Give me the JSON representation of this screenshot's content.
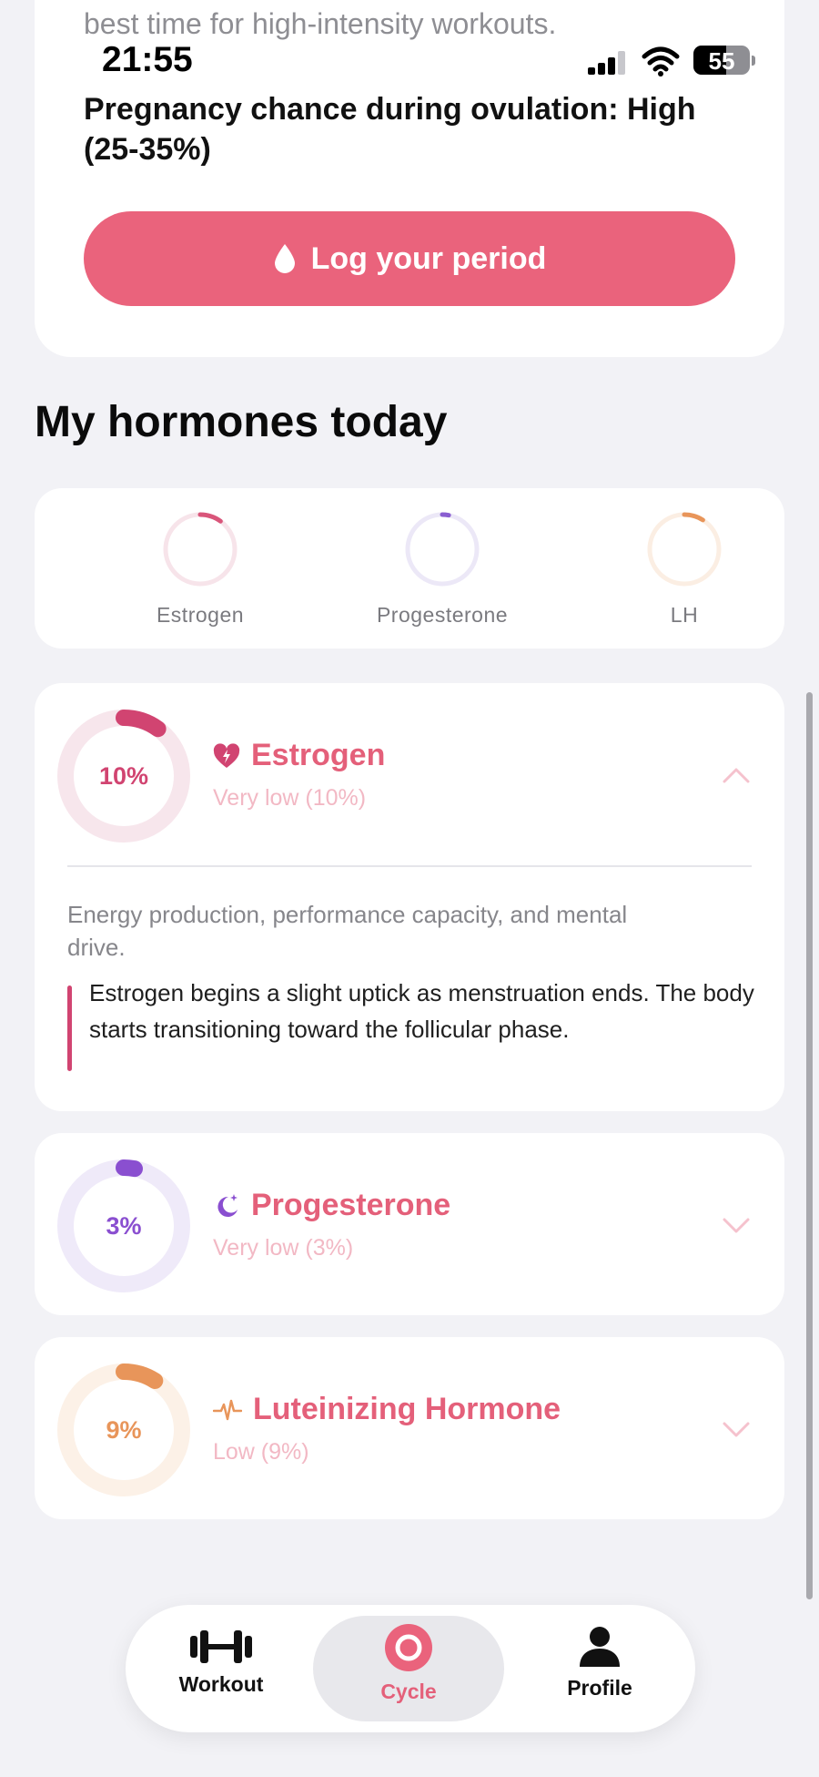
{
  "status_bar": {
    "time": "21:55",
    "battery": "55"
  },
  "top": {
    "faded_line": "best time for high-intensity workouts.",
    "pregnancy_text": "Pregnancy chance during ovulation: High (25-35%)",
    "log_button": "Log your period",
    "log_icon": "drop-icon"
  },
  "section_title": "My hormones today",
  "summary": [
    {
      "label": "Estrogen",
      "level": 0.1,
      "color": "#d9557a",
      "track": "#f7e4ea"
    },
    {
      "label": "Progesterone",
      "level": 0.03,
      "color": "#8a5fd1",
      "track": "#ece8f7"
    },
    {
      "label": "LH",
      "level": 0.09,
      "color": "#e8955a",
      "track": "#fbeee3"
    }
  ],
  "hormones": [
    {
      "name": "Estrogen",
      "value": "10%",
      "level": 0.1,
      "status": "Very low (10%)",
      "icon": "heart-bolt-icon",
      "color": "#d14471",
      "track": "#f7e6ec",
      "expanded": true,
      "description": "Energy production, performance capacity, and mental drive.",
      "note": "Estrogen begins a slight uptick as menstruation ends. The body starts transitioning toward the follicular phase."
    },
    {
      "name": "Progesterone",
      "value": "3%",
      "level": 0.03,
      "status": "Very low (3%)",
      "icon": "moon-sparkle-icon",
      "color": "#8a4fd0",
      "track": "#efeaf9",
      "expanded": false
    },
    {
      "name": "Luteinizing Hormone",
      "value": "9%",
      "level": 0.09,
      "status": "Low (9%)",
      "icon": "pulse-icon",
      "color": "#e8955a",
      "track": "#fcf1e7",
      "expanded": false
    }
  ],
  "tabs": [
    {
      "label": "Workout",
      "icon": "dumbbell-icon",
      "active": false
    },
    {
      "label": "Cycle",
      "icon": "cycle-ring-icon",
      "active": true
    },
    {
      "label": "Profile",
      "icon": "person-icon",
      "active": false
    }
  ],
  "colors": {
    "accent": "#ea637c",
    "background": "#f2f2f6"
  }
}
